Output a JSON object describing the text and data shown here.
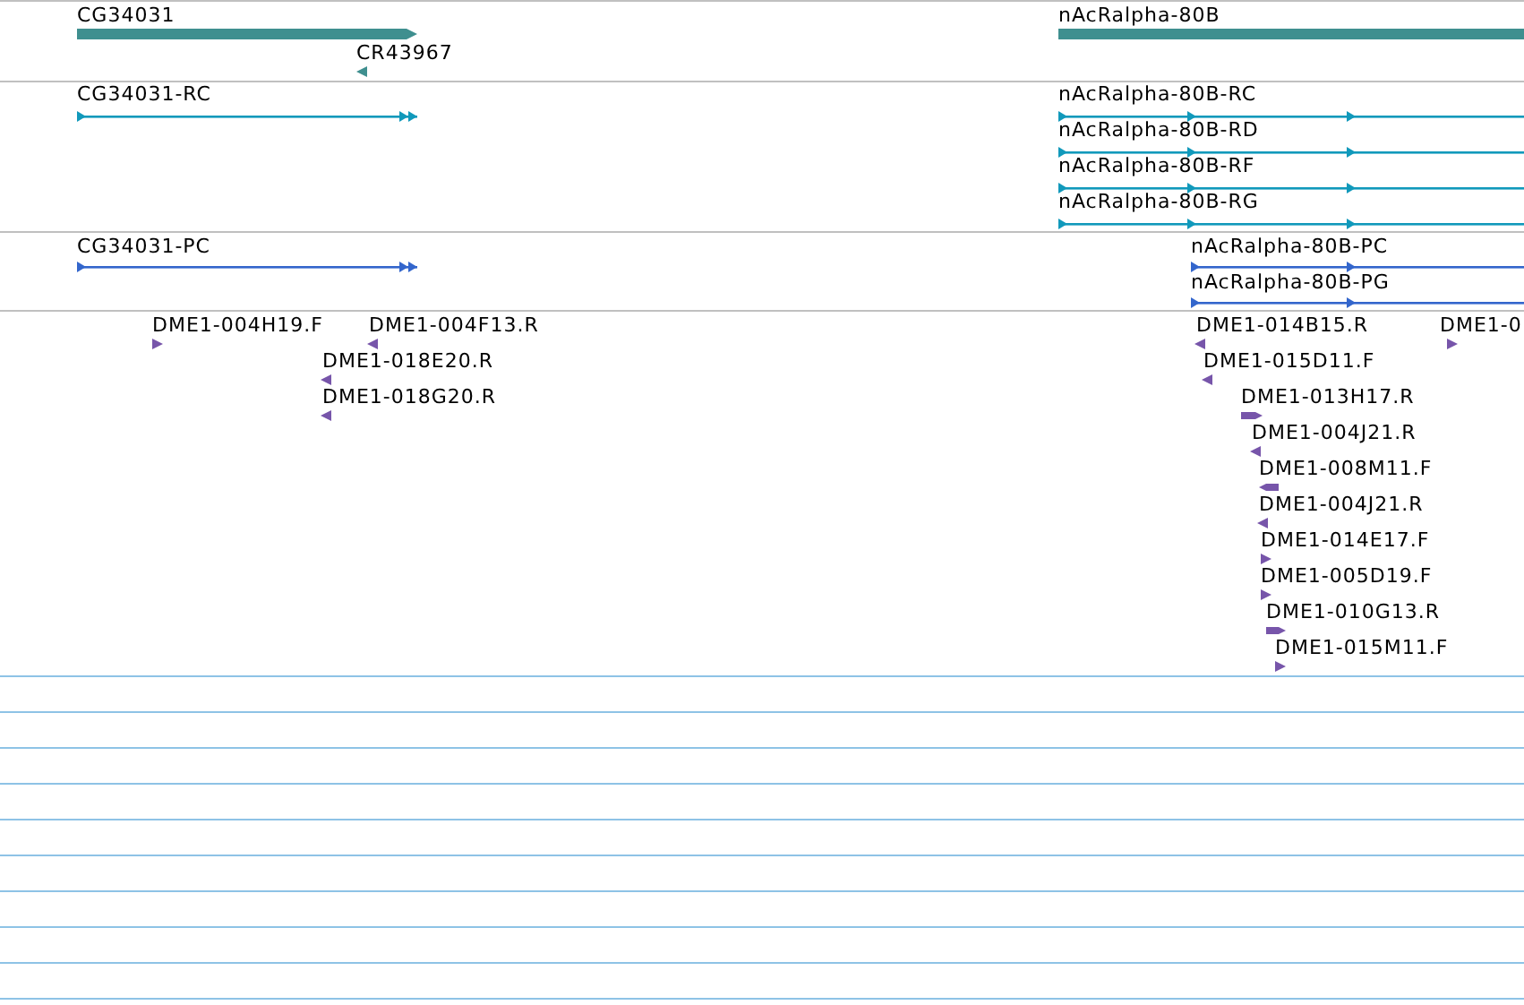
{
  "tracks": [
    {
      "kind": "genes",
      "features": [
        {
          "label": "CG34031",
          "reverse": false
        },
        {
          "label": "CR43967",
          "reverse": true
        },
        {
          "label": "nAcRalpha-80B"
        }
      ]
    },
    {
      "kind": "transcripts",
      "features": [
        {
          "label": "CG34031-RC",
          "reverse": false
        },
        {
          "label": "nAcRalpha-80B-RC",
          "reverse": false
        },
        {
          "label": "nAcRalpha-80B-RD",
          "reverse": false
        },
        {
          "label": "nAcRalpha-80B-RF",
          "reverse": false
        },
        {
          "label": "nAcRalpha-80B-RG",
          "reverse": false
        }
      ]
    },
    {
      "kind": "proteins",
      "features": [
        {
          "label": "CG34031-PC",
          "reverse": false
        },
        {
          "label": "nAcRalpha-80B-PC",
          "reverse": false
        },
        {
          "label": "nAcRalpha-80B-PG",
          "reverse": false
        }
      ]
    },
    {
      "kind": "clones",
      "features": [
        {
          "label": "DME1-004H19.F",
          "reverse": false
        },
        {
          "label": "DME1-004F13.R",
          "reverse": true
        },
        {
          "label": "DME1-018E20.R",
          "reverse": true
        },
        {
          "label": "DME1-018G20.R",
          "reverse": true
        },
        {
          "label": "DME1-014B15.R",
          "reverse": true
        },
        {
          "label": "DME1-0",
          "reverse": false
        },
        {
          "label": "DME1-015D11.F",
          "reverse": true
        },
        {
          "label": "DME1-013H17.R",
          "reverse": false
        },
        {
          "label": "DME1-004J21.R",
          "reverse": true
        },
        {
          "label": "DME1-008M11.F",
          "reverse": true
        },
        {
          "label": "DME1-004J21.R",
          "reverse": true
        },
        {
          "label": "DME1-014E17.F",
          "reverse": false
        },
        {
          "label": "DME1-005D19.F",
          "reverse": false
        },
        {
          "label": "DME1-010G13.R",
          "reverse": false
        },
        {
          "label": "DME1-015M11.F",
          "reverse": false
        }
      ]
    }
  ]
}
